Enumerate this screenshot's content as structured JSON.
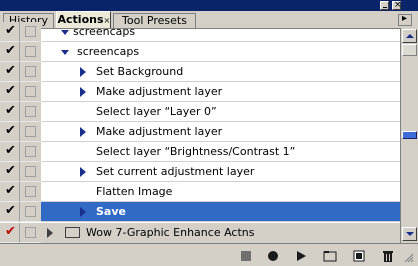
{
  "tabs": [
    {
      "label": "History"
    },
    {
      "label": "Actions"
    },
    {
      "label": "Tool Presets"
    }
  ],
  "rows": [
    {
      "label": "screencaps",
      "checked": true
    },
    {
      "label": "screencaps",
      "checked": true
    },
    {
      "label": "Set Background",
      "checked": true
    },
    {
      "label": "Make adjustment layer",
      "checked": true
    },
    {
      "label": "Select layer “Layer 0”",
      "checked": true
    },
    {
      "label": "Make adjustment layer",
      "checked": true
    },
    {
      "label": "Select layer “Brightness/Contrast 1”",
      "checked": true
    },
    {
      "label": "Set current adjustment layer",
      "checked": true
    },
    {
      "label": "Flatten Image",
      "checked": true
    },
    {
      "label": "Save",
      "checked": true
    },
    {
      "label": "Wow 7-Graphic Enhance Actns",
      "checked": true
    }
  ],
  "colors": {
    "selection": "#316ac5",
    "record_red": "#c00000",
    "check": "#000000"
  },
  "icons": {
    "stop": "stop-icon",
    "record": "record-icon",
    "play": "play-icon",
    "new_set": "new-set-folder-icon",
    "new_action": "new-action-icon",
    "delete": "trash-icon"
  }
}
